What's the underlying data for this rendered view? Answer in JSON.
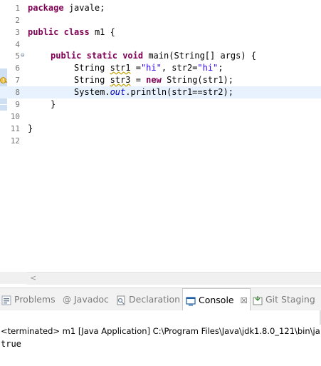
{
  "editor": {
    "lines": [
      {
        "num": "1"
      },
      {
        "num": "2"
      },
      {
        "num": "3"
      },
      {
        "num": "4"
      },
      {
        "num": "5"
      },
      {
        "num": "6"
      },
      {
        "num": "7"
      },
      {
        "num": "8"
      },
      {
        "num": "9"
      },
      {
        "num": "10"
      },
      {
        "num": "11"
      },
      {
        "num": "12"
      }
    ],
    "code": {
      "l1_kw": "package",
      "l1_rest": " javale;",
      "l3_kw1": "public",
      "l3_kw2": "class",
      "l3_rest": " m1 {",
      "l5_kw1": "public",
      "l5_kw2": "static",
      "l5_kw3": "void",
      "l5_rest": " main(String[] args) {",
      "l6_a": "String ",
      "l6_var": "str1",
      "l6_b": " =",
      "l6_s1": "\"hi\"",
      "l6_c": ", str2=",
      "l6_s2": "\"hi\"",
      "l6_d": ";",
      "l7_a": "String ",
      "l7_var": "str3",
      "l7_b": " = ",
      "l7_kw": "new",
      "l7_c": " String(str1);",
      "l8_a": "System.",
      "l8_fld": "out",
      "l8_b": ".println(str1==str2);",
      "l9": "}",
      "l11": "}"
    }
  },
  "tabs": [
    {
      "label": "Problems",
      "icon": "problems-icon"
    },
    {
      "label": "Javadoc",
      "icon": "javadoc-icon"
    },
    {
      "label": "Declaration",
      "icon": "declaration-icon"
    },
    {
      "label": "Console",
      "icon": "console-icon",
      "close": "☒"
    },
    {
      "label": "Git Staging",
      "icon": "git-staging-icon"
    }
  ],
  "console": {
    "status": "<terminated> m1 [Java Application] C:\\Program Files\\Java\\jdk1.8.0_121\\bin\\ja",
    "output": "true"
  },
  "scroll": {
    "left_arrow": "<"
  },
  "colors": {
    "keyword": "#7f0055",
    "string": "#2a00ff",
    "field": "#0000c0",
    "current_line": "#e8f2fe"
  }
}
